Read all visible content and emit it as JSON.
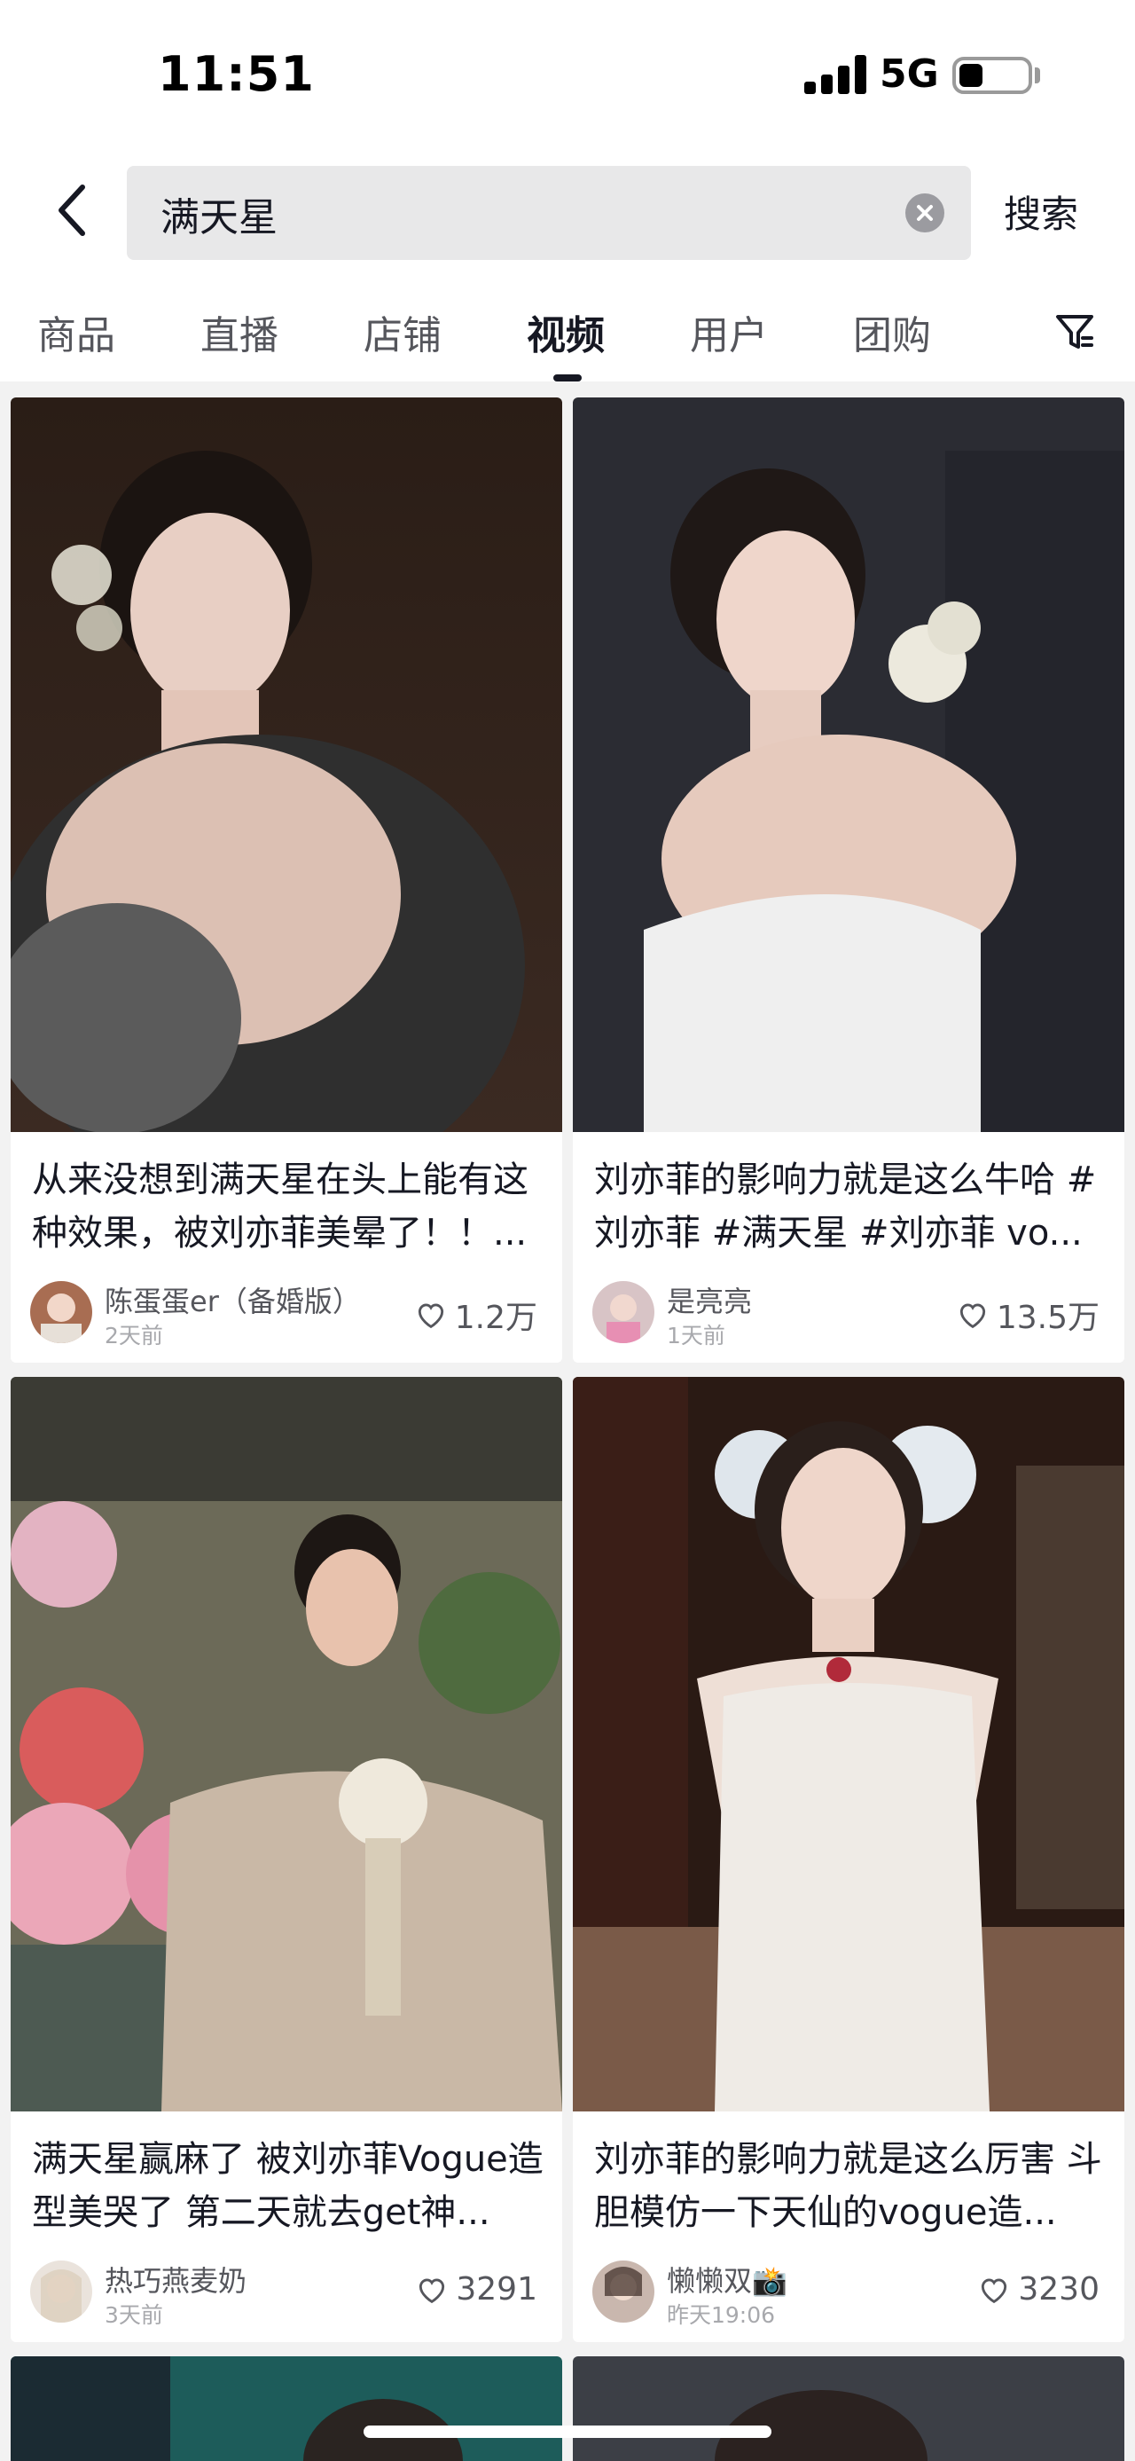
{
  "status_bar": {
    "time": "11:51",
    "network": "5G"
  },
  "search": {
    "query": "满天星",
    "submit_label": "搜索",
    "clear_icon": "clear-circle-icon",
    "back_icon": "chevron-left-icon"
  },
  "tabs": [
    {
      "label": "商品",
      "active": false
    },
    {
      "label": "直播",
      "active": false
    },
    {
      "label": "店铺",
      "active": false
    },
    {
      "label": "视频",
      "active": true
    },
    {
      "label": "用户",
      "active": false
    },
    {
      "label": "团购",
      "active": false
    }
  ],
  "filter_icon": "filter-funnel-icon",
  "videos": [
    {
      "title": "从来没想到满天星在头上能有这种效果，被刘亦菲美晕了！！...",
      "author": "陈蛋蛋er（备婚版）",
      "posted": "2天前",
      "likes": "1.2万",
      "thumb_colors": [
        "#2a1d16",
        "#5a3a2c"
      ]
    },
    {
      "title": "刘亦菲的影响力就是这么牛哈 #刘亦菲 #满天星 #刘亦菲 vo...",
      "author": "是亮亮",
      "posted": "1天前",
      "likes": "13.5万",
      "thumb_colors": [
        "#2b2c33",
        "#6d6e78"
      ]
    },
    {
      "title": "满天星赢麻了 被刘亦菲Vogue造型美哭了 第二天就去get神...",
      "author": "热巧燕麦奶",
      "posted": "3天前",
      "likes": "3291",
      "thumb_colors": [
        "#5b5e48",
        "#d7b8a2"
      ]
    },
    {
      "title": "刘亦菲的影响力就是这么厉害 斗胆模仿一下天仙的vogue造...",
      "author": "懒懒双📸",
      "posted": "昨天19:06",
      "likes": "3230",
      "thumb_colors": [
        "#2a1a14",
        "#8a6a5a"
      ]
    }
  ],
  "colors": {
    "text_primary": "#161823",
    "text_secondary": "#55565c",
    "background": "#f2f2f2"
  }
}
